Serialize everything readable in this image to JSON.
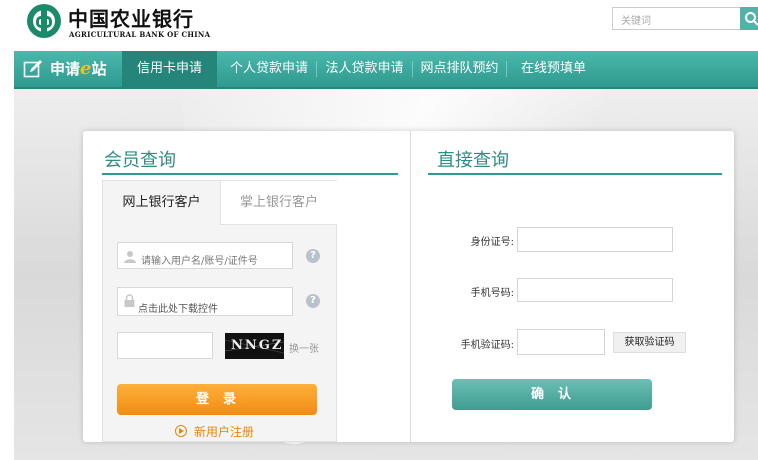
{
  "header": {
    "brand_cn": "中国农业银行",
    "brand_en": "AGRICULTURAL BANK OF CHINA",
    "search_placeholder": "关键词"
  },
  "nav": {
    "brand_text": "申请",
    "brand_e": "e",
    "brand_suffix": "站",
    "items": [
      {
        "label": "信用卡申请",
        "active": true
      },
      {
        "label": "个人贷款申请",
        "active": false
      },
      {
        "label": "法人贷款申请",
        "active": false
      },
      {
        "label": "网点排队预约",
        "active": false
      },
      {
        "label": "在线预填单",
        "active": false
      }
    ]
  },
  "member": {
    "title": "会员查询",
    "tabs": [
      {
        "label": "网上银行客户",
        "active": true
      },
      {
        "label": "掌上银行客户",
        "active": false
      }
    ],
    "username_placeholder": "请输入用户名/账号/证件号",
    "password_placeholder": "点击此处下载控件",
    "captcha_text": "NNGZ",
    "refresh_label": "换一张",
    "login_label": "登录",
    "register_label": "新用户注册"
  },
  "direct": {
    "title": "直接查询",
    "id_label": "身份证号:",
    "phone_label": "手机号码:",
    "sms_label": "手机验证码:",
    "sms_button": "获取验证码",
    "confirm_label": "确认"
  },
  "colors": {
    "teal": "#2f9a8f",
    "orange": "#f28c14",
    "logo_green": "#1a8a6b"
  }
}
